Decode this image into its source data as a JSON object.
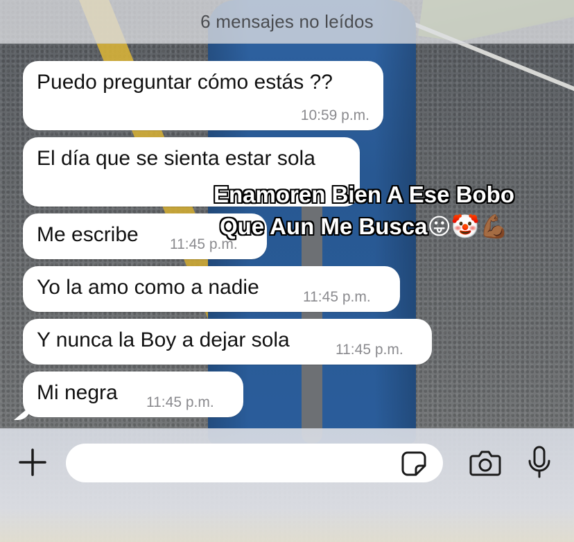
{
  "banner": {
    "unread_text": "6 mensajes no leídos"
  },
  "messages": [
    {
      "text": "Puedo preguntar cómo estás ??",
      "time": "10:59 p.m."
    },
    {
      "text": "El día que se sienta estar sola",
      "time": ""
    },
    {
      "text": "Me escribe",
      "time": "11:45 p.m."
    },
    {
      "text": "Yo la amo como a nadie",
      "time": "11:45 p.m."
    },
    {
      "text": "Y nunca la Boy a dejar sola",
      "time": "11:45 p.m."
    },
    {
      "text": "Mi negra",
      "time": "11:45 p.m."
    }
  ],
  "overlay": {
    "line1": "Enamoren Bien A Ese Bobo",
    "line2": "Que Aun Me Busca",
    "emojis": "😛🤡💪🏾"
  },
  "composer": {
    "input_value": "",
    "icons": [
      "plus-icon",
      "sticker-icon",
      "camera-icon",
      "microphone-icon"
    ]
  },
  "colors": {
    "bubble": "#ffffff",
    "timestamp": "#8a8a8e",
    "message_text": "#111111",
    "banner_text": "#4a4c50"
  }
}
